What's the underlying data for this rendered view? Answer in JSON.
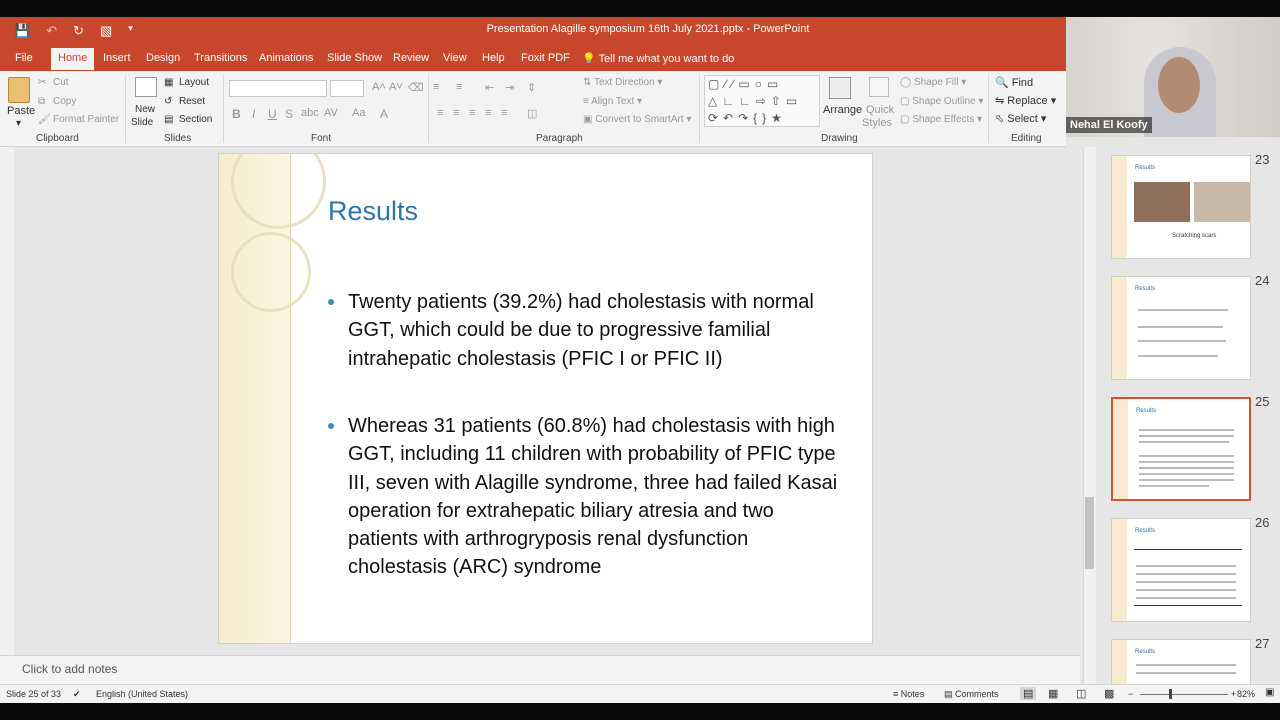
{
  "window": {
    "title": "Presentation Alagille symposium 16th July 2021.pptx  -  PowerPoint"
  },
  "tabs": [
    "File",
    "Home",
    "Insert",
    "Design",
    "Transitions",
    "Animations",
    "Slide Show",
    "Review",
    "View",
    "Help",
    "Foxit PDF"
  ],
  "tell_me": "Tell me what you want to do",
  "ribbon": {
    "clipboard": {
      "paste": "Paste",
      "cut": "Cut",
      "copy": "Copy",
      "format_painter": "Format Painter",
      "label": "Clipboard"
    },
    "slides": {
      "new_slide": "New",
      "new_slide2": "Slide",
      "layout": "Layout",
      "reset": "Reset",
      "section": "Section",
      "label": "Slides"
    },
    "font": {
      "label": "Font"
    },
    "paragraph": {
      "text_direction": "Text Direction",
      "align_text": "Align Text",
      "smartart": "Convert to SmartArt",
      "label": "Paragraph"
    },
    "drawing": {
      "arrange": "Arrange",
      "quick_styles": "Quick",
      "quick_styles2": "Styles",
      "shape_fill": "Shape Fill",
      "shape_outline": "Shape Outline",
      "shape_effects": "Shape Effects",
      "label": "Drawing"
    },
    "editing": {
      "find": "Find",
      "replace": "Replace",
      "select": "Select",
      "label": "Editing"
    }
  },
  "video": {
    "participant": "Nehal El Koofy"
  },
  "slide": {
    "title": "Results",
    "bullet1": "Twenty patients (39.2%) had cholestasis with normal GGT, which could be due to progressive familial intrahepatic cholestasis (PFIC I or PFIC II)",
    "bullet2": "Whereas 31 patients (60.8%) had cholestasis with high GGT, including 11 children with probability of PFIC type III, seven with Alagille syndrome, three had failed Kasai operation for extrahepatic biliary atresia and two patients with arthrogryposis renal dysfunction cholestasis (ARC) syndrome"
  },
  "thumbnails": [
    {
      "num": "23",
      "title": "Results",
      "caption": "Scratching scars"
    },
    {
      "num": "24",
      "title": "Results"
    },
    {
      "num": "25",
      "title": "Results"
    },
    {
      "num": "26",
      "title": "Results"
    },
    {
      "num": "27",
      "title": "Results"
    }
  ],
  "notes_placeholder": "Click to add notes",
  "status": {
    "slide_count": "Slide 25 of 33",
    "language": "English (United States)",
    "notes": "Notes",
    "comments": "Comments",
    "zoom": "82%"
  },
  "colors": {
    "accent": "#c8472c",
    "title_blue": "#2d74a8",
    "selected_border": "#d35230"
  }
}
